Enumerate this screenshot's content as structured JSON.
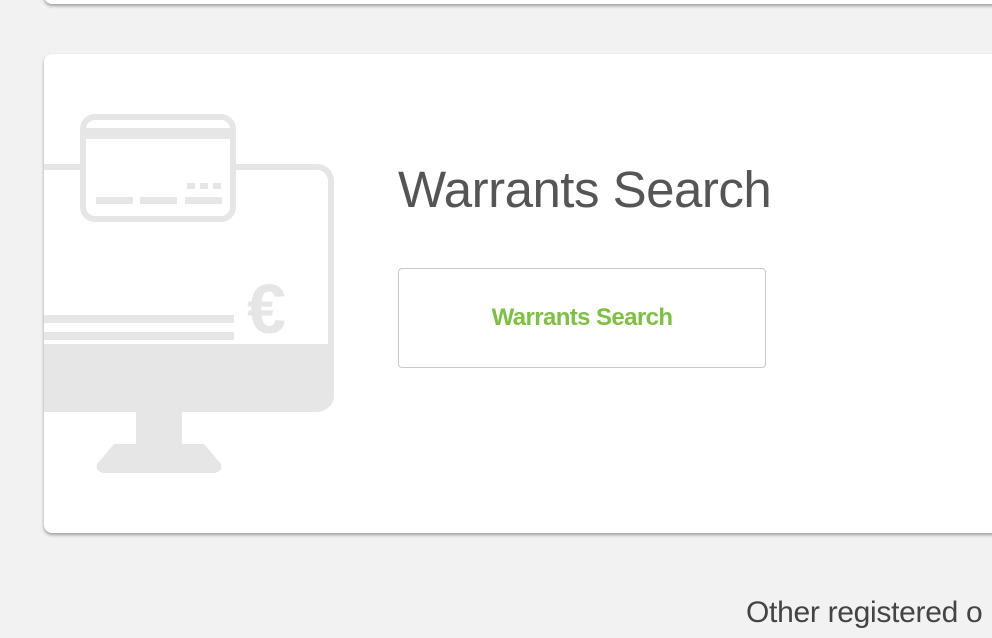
{
  "warrants_card": {
    "title": "Warrants Search",
    "button_label": "Warrants Search",
    "illustration_icon": "monitor-with-card-and-euro-icon",
    "euro_symbol": "€"
  },
  "footer": {
    "text": "Other registered o"
  },
  "colors": {
    "background": "#f2f2f2",
    "card": "#ffffff",
    "accent_green": "#7cc142",
    "title_gray": "#555555",
    "illustration_gray": "#e6e6e6"
  }
}
